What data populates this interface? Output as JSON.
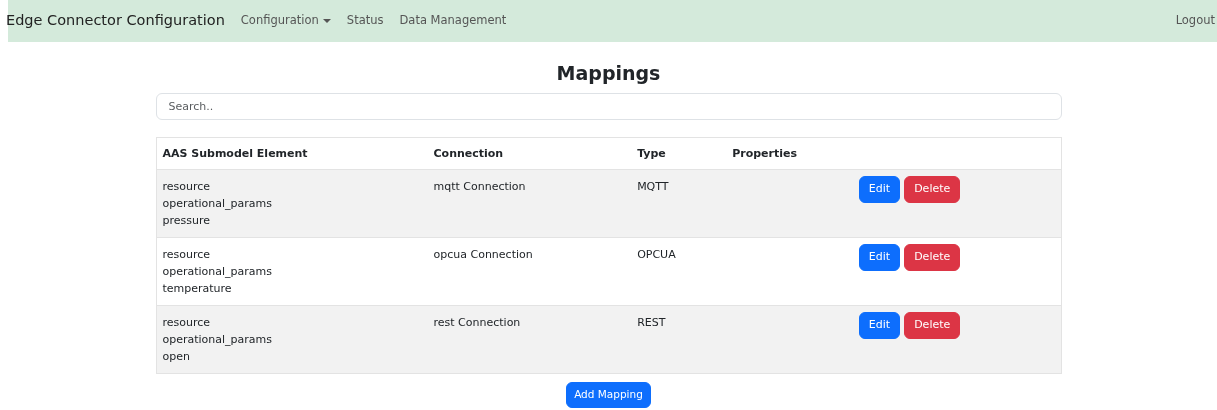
{
  "navbar": {
    "brand": "Edge Connector Configuration",
    "items": [
      {
        "label": "Configuration",
        "kind": "dropdown"
      },
      {
        "label": "Status",
        "kind": "link"
      },
      {
        "label": "Data Management",
        "kind": "link"
      }
    ],
    "logout": "Logout"
  },
  "heading": "Mappings",
  "search": {
    "placeholder": "Search.."
  },
  "table": {
    "columns": [
      "AAS Submodel Element",
      "Connection",
      "Type",
      "Properties"
    ],
    "rows": [
      {
        "element": [
          "resource",
          "operational_params",
          "pressure"
        ],
        "connection": "mqtt Connection",
        "type": "MQTT",
        "actions": [
          "Edit",
          "Delete"
        ]
      },
      {
        "element": [
          "resource",
          "operational_params",
          "temperature"
        ],
        "connection": "opcua Connection",
        "type": "OPCUA",
        "actions": [
          "Edit",
          "Delete"
        ]
      },
      {
        "element": [
          "resource",
          "operational_params",
          "open"
        ],
        "connection": "rest Connection",
        "type": "REST",
        "actions": [
          "Edit",
          "Delete"
        ]
      }
    ]
  },
  "add_button": "Add Mapping"
}
